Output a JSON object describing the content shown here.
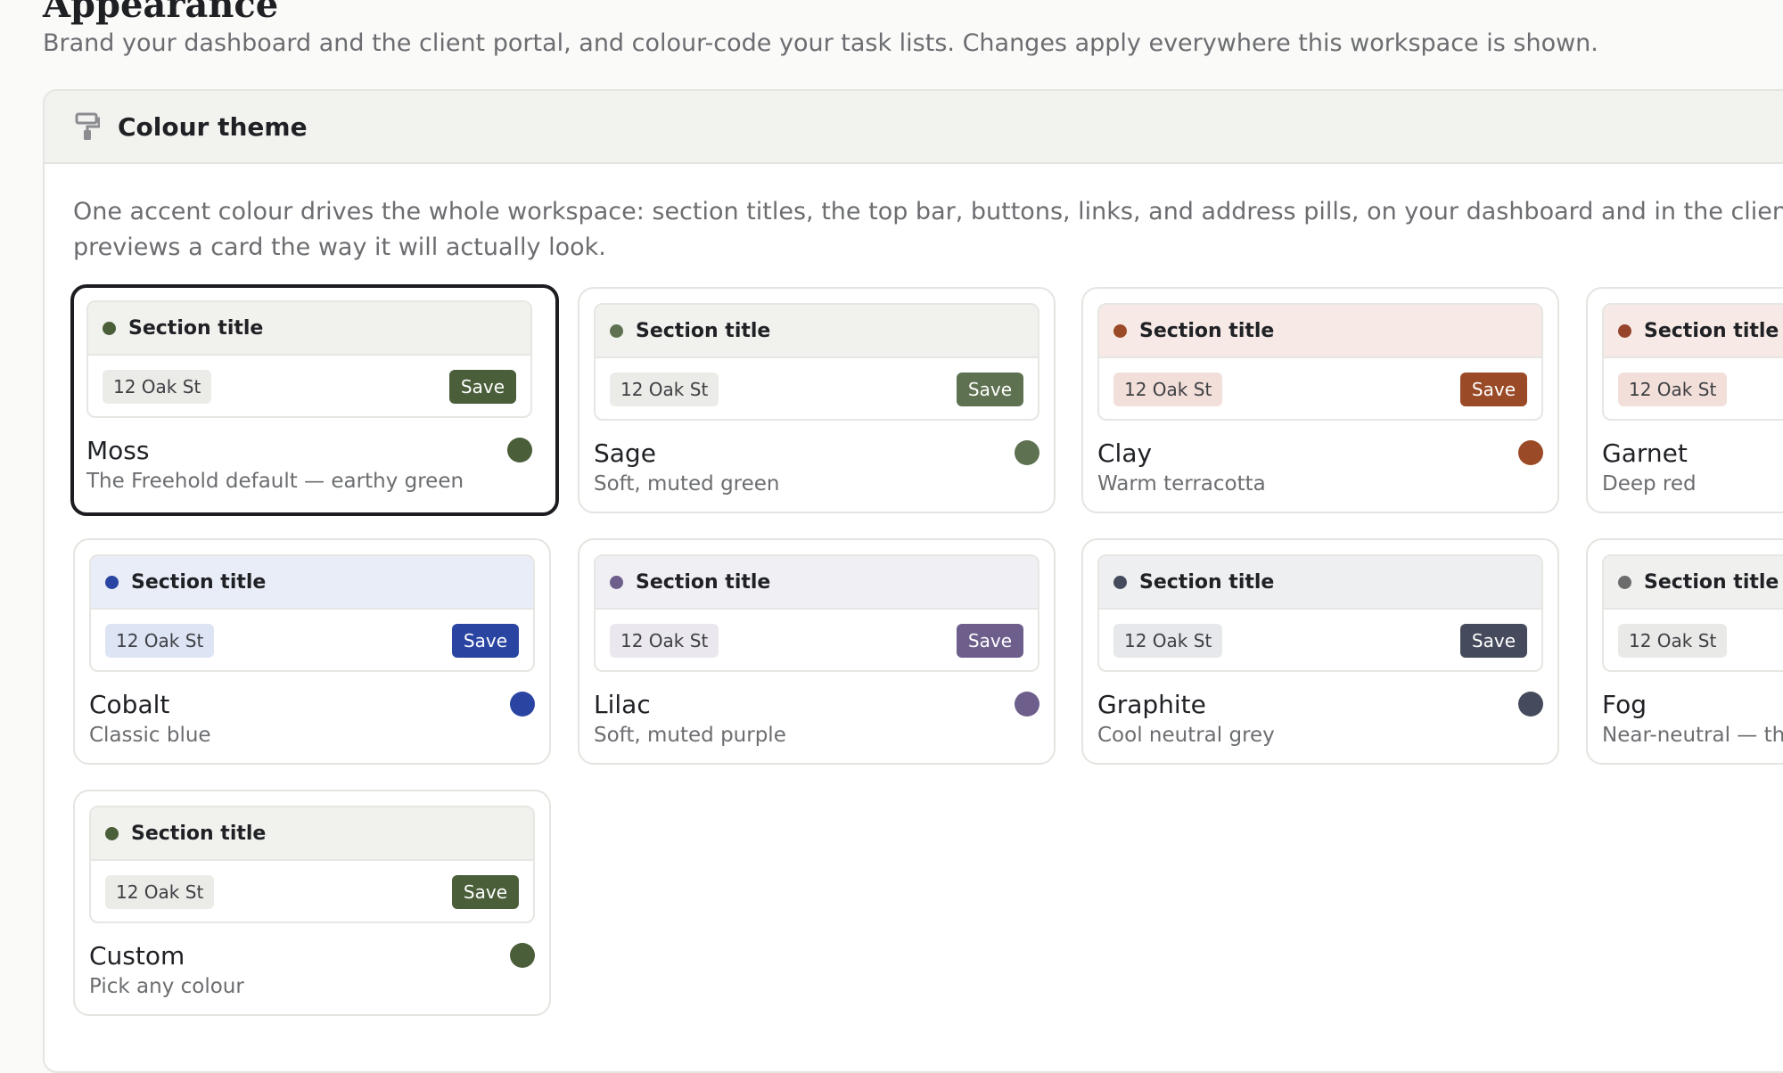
{
  "header": {
    "title": "Appearance",
    "subtitle": "Brand your dashboard and the client portal, and colour-code your task lists. Changes apply everywhere this workspace is shown."
  },
  "panel": {
    "title": "Colour theme",
    "icon": "paint-roller-icon",
    "description_line1": "One accent colour drives the whole workspace: section titles, the top bar, buttons, links, and address pills, on your dashboard and in the client portal. E",
    "description_line2": "previews a card the way it will actually look."
  },
  "preview": {
    "section_title": "Section title",
    "address": "12 Oak St",
    "save_label": "Save"
  },
  "themes": [
    {
      "name": "Moss",
      "description": "The Freehold default — earthy green",
      "selected": true,
      "accent": "#4a5e3a",
      "head_bg": "#f1f1ee",
      "pill_bg": "#ebebe7"
    },
    {
      "name": "Sage",
      "description": "Soft, muted green",
      "selected": false,
      "accent": "#5e7150",
      "head_bg": "#f1f1ee",
      "pill_bg": "#ebebe7"
    },
    {
      "name": "Clay",
      "description": "Warm terracotta",
      "selected": false,
      "accent": "#9a4a26",
      "head_bg": "#f6e9e6",
      "pill_bg": "#f3dfda"
    },
    {
      "name": "Garnet",
      "description": "Deep red",
      "selected": false,
      "accent": "#96452b",
      "head_bg": "#f6e9e6",
      "pill_bg": "#f3dfda"
    },
    {
      "name": "Cobalt",
      "description": "Classic blue",
      "selected": false,
      "accent": "#2a44a2",
      "head_bg": "#e9edf7",
      "pill_bg": "#dde4f4"
    },
    {
      "name": "Lilac",
      "description": "Soft, muted purple",
      "selected": false,
      "accent": "#6d5e8c",
      "head_bg": "#f0eff3",
      "pill_bg": "#eae8ee"
    },
    {
      "name": "Graphite",
      "description": "Cool neutral grey",
      "selected": false,
      "accent": "#454b5c",
      "head_bg": "#eeeff1",
      "pill_bg": "#e7e8eb"
    },
    {
      "name": "Fog",
      "description": "Near-neutral — the",
      "selected": false,
      "accent": "#6c6c6c",
      "head_bg": "#f0f0ee",
      "pill_bg": "#e9e9e7"
    },
    {
      "name": "Custom",
      "description": "Pick any colour",
      "selected": false,
      "accent": "#4a5e3a",
      "head_bg": "#f1f1ee",
      "pill_bg": "#ebebe7"
    }
  ]
}
